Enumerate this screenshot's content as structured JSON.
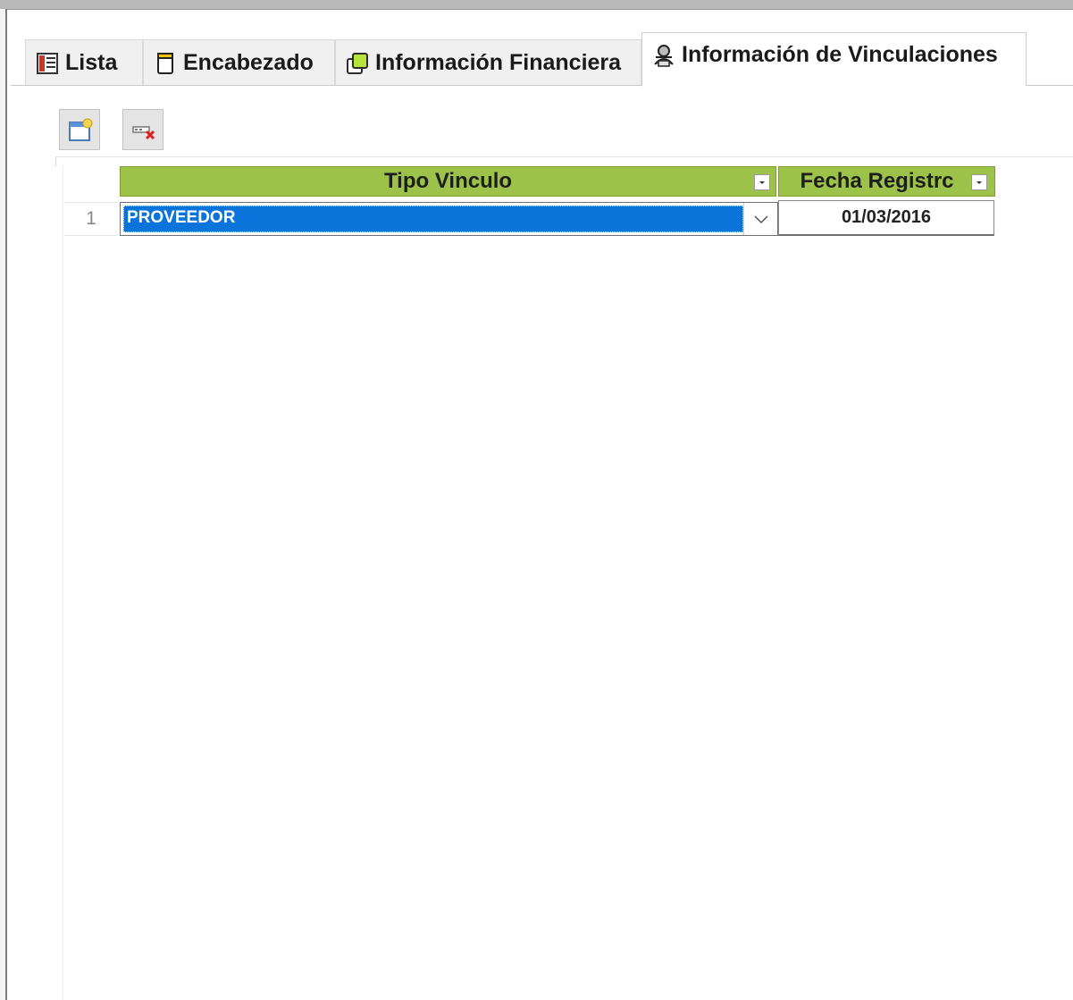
{
  "tabs": [
    {
      "label": "Lista",
      "icon": "list-icon",
      "active": false
    },
    {
      "label": "Encabezado",
      "icon": "document-icon",
      "active": false
    },
    {
      "label": "Información Financiera",
      "icon": "pages-icon",
      "active": false
    },
    {
      "label": "Información de Vinculaciones",
      "icon": "people-link-icon",
      "active": true
    }
  ],
  "toolbar": {
    "new_icon": "new-record-icon",
    "delete_icon": "delete-record-icon"
  },
  "grid": {
    "columns": [
      {
        "header": "Tipo Vinculo"
      },
      {
        "header": "Fecha Registrc"
      }
    ],
    "rows": [
      {
        "num": "1",
        "tipo_vinculo": "PROVEEDOR",
        "fecha_registro": "01/03/2016"
      }
    ]
  },
  "colors": {
    "header_green": "#9dc24a",
    "selection_blue": "#0a74da"
  }
}
